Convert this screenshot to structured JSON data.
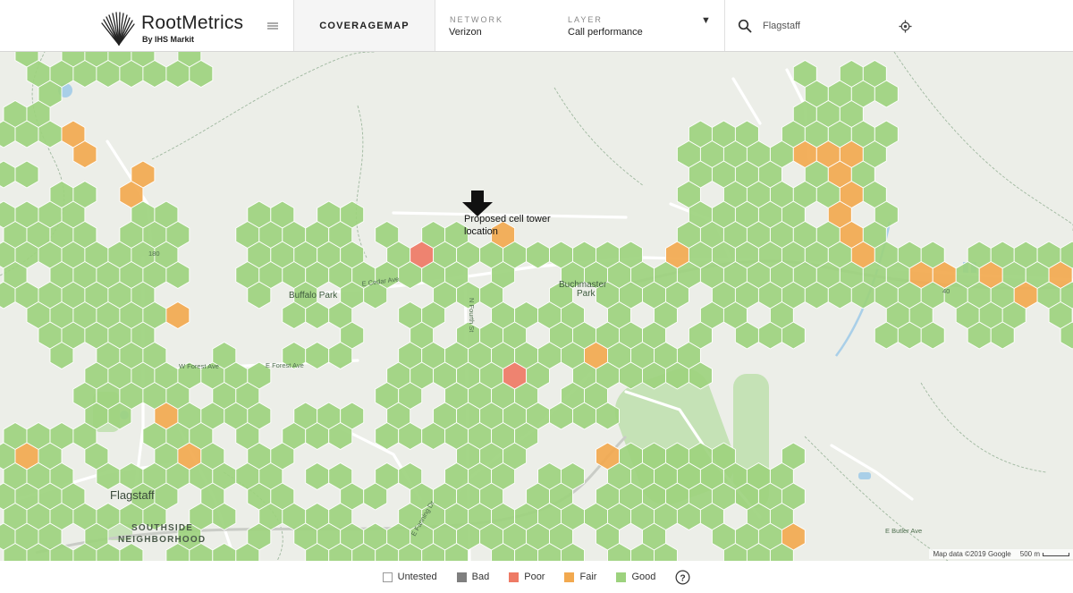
{
  "header": {
    "brand_name": "RootMetrics",
    "brand_sub": "By IHS Markit",
    "coverage_tab": "COVERAGEMAP",
    "network_label": "NETWORK",
    "network_value": "Verizon",
    "layer_label": "LAYER",
    "layer_value": "Call performance",
    "search_value": "Flagstaff",
    "icons": [
      "logo-fan-icon",
      "menu-icon",
      "chevron-down-icon",
      "search-icon",
      "locate-icon"
    ]
  },
  "map": {
    "annotation_line1": "Proposed cell tower",
    "annotation_line2": "location",
    "labels": [
      "Buffalo Park",
      "Buchmaster",
      "Park",
      "W Forest Ave",
      "E Forest Ave",
      "E Cedar Ave",
      "N Fourth St",
      "E Butler Ave",
      "Flagstaff",
      "SOUTHSIDE",
      "NEIGHBORHOOD",
      "E Fanning Dr",
      "180",
      "40"
    ],
    "attribution": "Map data ©2019 Google",
    "scale": "500 m",
    "hex_colors": {
      "good": "#9dd27e",
      "fair": "#f2a94f",
      "poor": "#ee7a65",
      "bad": "#7f7f7f"
    },
    "base_color": "#eceee8",
    "road_color": "#ffffff",
    "water_color": "#a9cfe8",
    "park_color": "#c5e2b6"
  },
  "legend": [
    {
      "label": "Untested",
      "color": "#ffffff"
    },
    {
      "label": "Bad",
      "color": "#7f7f7f"
    },
    {
      "label": "Poor",
      "color": "#ee7a65"
    },
    {
      "label": "Fair",
      "color": "#f2a94f"
    },
    {
      "label": "Good",
      "color": "#9dd27e"
    }
  ]
}
